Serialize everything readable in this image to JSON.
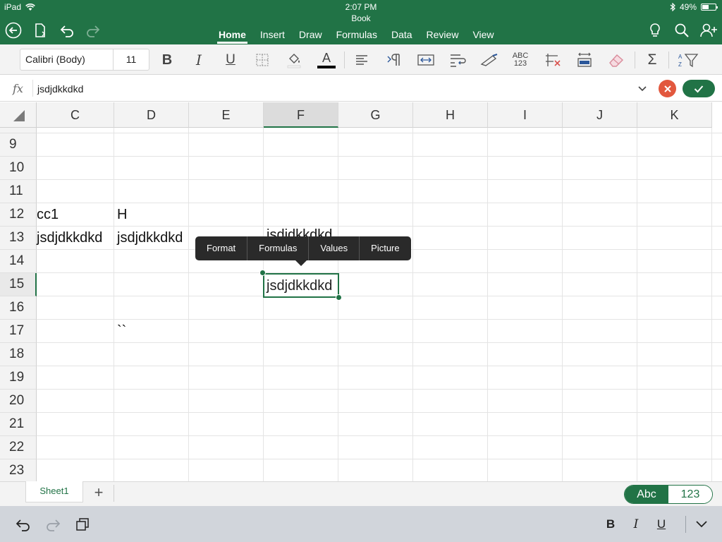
{
  "status_bar": {
    "device": "iPad",
    "time": "2:07 PM",
    "battery": "49%"
  },
  "document": {
    "title": "Book"
  },
  "ribbon_tabs": [
    {
      "label": "Home",
      "active": true
    },
    {
      "label": "Insert",
      "active": false
    },
    {
      "label": "Draw",
      "active": false
    },
    {
      "label": "Formulas",
      "active": false
    },
    {
      "label": "Data",
      "active": false
    },
    {
      "label": "Review",
      "active": false
    },
    {
      "label": "View",
      "active": false
    }
  ],
  "ribbon": {
    "font_name": "Calibri (Body)",
    "font_size": "11",
    "bold_label": "B",
    "italic_label": "I",
    "underline_label": "U",
    "font_color_label": "A",
    "number_format_label_top": "ABC",
    "number_format_label_bottom": "123",
    "autosum_label": "Σ"
  },
  "formula_bar": {
    "fx_label": "fx",
    "value": "jsdjdkkdkd"
  },
  "grid": {
    "columns": [
      "C",
      "D",
      "E",
      "F",
      "G",
      "H",
      "I",
      "J",
      "K"
    ],
    "selected_column": "F",
    "rows": [
      "9",
      "10",
      "11",
      "12",
      "13",
      "14",
      "15",
      "16",
      "17",
      "18",
      "19",
      "20",
      "21",
      "22",
      "23"
    ],
    "selected_row": "15",
    "cells": {
      "C12": "cc1",
      "D12": "H",
      "C13": "jsdjdkkdkd",
      "D13": "jsdjdkkdkd",
      "F13": "jsdjdkkdkd",
      "F15": "jsdjdkkdkd",
      "D17": "``"
    }
  },
  "context_menu": {
    "items": [
      "Format",
      "Formulas",
      "Values",
      "Picture"
    ]
  },
  "sheet_bar": {
    "sheets": [
      "Sheet1"
    ],
    "add_label": "+",
    "keyboard_toggle": {
      "text_label": "Abc",
      "number_label": "123"
    }
  },
  "keyboard_bar": {
    "bold_label": "B",
    "italic_label": "I",
    "underline_label": "U"
  },
  "colors": {
    "excel_green": "#217346",
    "cancel_red": "#e2583e"
  }
}
